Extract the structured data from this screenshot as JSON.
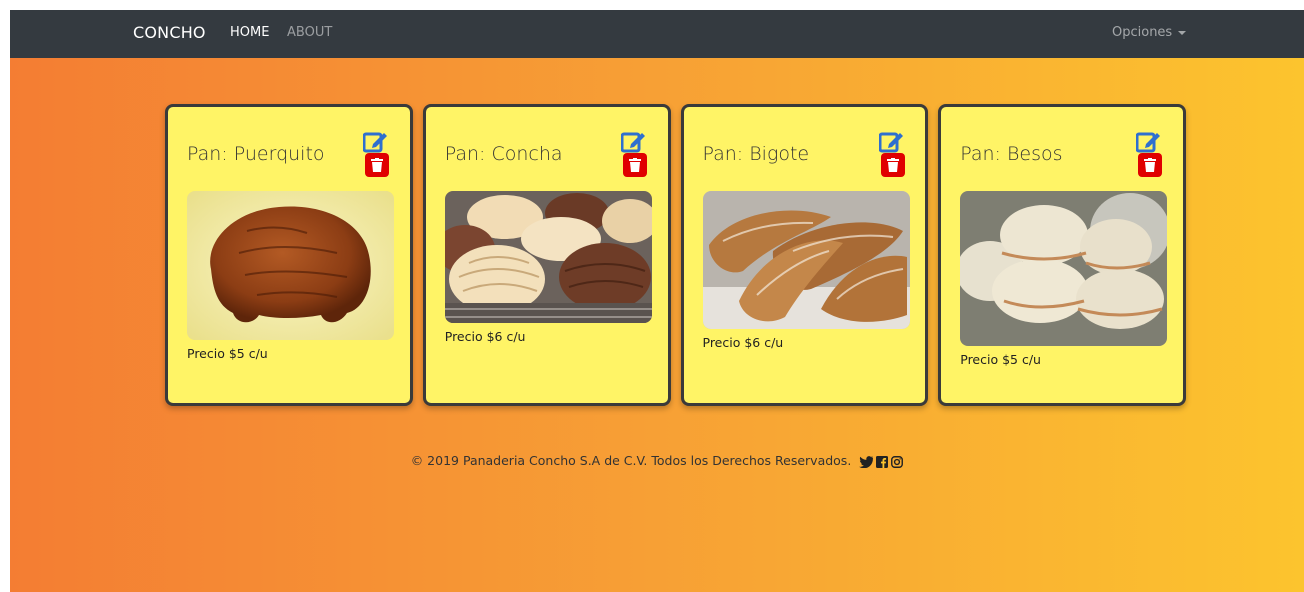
{
  "navbar": {
    "brand": "CONCHO",
    "links": [
      {
        "label": "HOME",
        "active": true
      },
      {
        "label": "ABOUT",
        "active": false
      }
    ],
    "options_label": "Opciones"
  },
  "products": [
    {
      "title": "Pan: Puerquito",
      "price": "Precio $5 c/u",
      "image": "puerquito-bread-photo"
    },
    {
      "title": "Pan: Concha",
      "price": "Precio $6 c/u",
      "image": "concha-bread-photo"
    },
    {
      "title": "Pan: Bigote",
      "price": "Precio $6 c/u",
      "image": "bigote-bread-photo"
    },
    {
      "title": "Pan: Besos",
      "price": "Precio $5 c/u",
      "image": "besos-bread-photo"
    }
  ],
  "footer": {
    "text": "© 2019 Panaderia Concho S.A de C.V. Todos los Derechos Reservados.",
    "social_icons": [
      "twitter-icon",
      "facebook-icon",
      "instagram-icon"
    ]
  },
  "colors": {
    "navbar": "#343a40",
    "gradient_start": "#f47d33",
    "gradient_end": "#fcc42e",
    "card": "#fff466",
    "edit_icon": "#2f6fcf",
    "delete_button": "#e00000"
  }
}
